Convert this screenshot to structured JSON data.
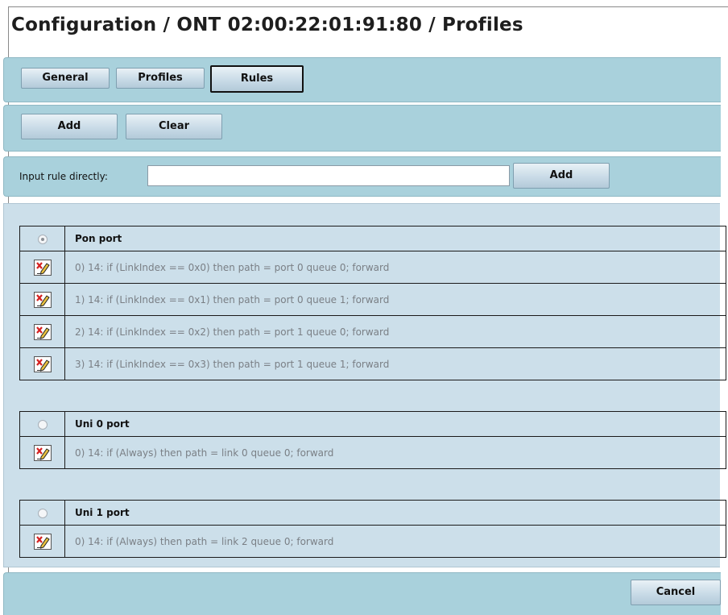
{
  "header": {
    "title": "Configuration / ONT 02:00:22:01:91:80 / Profiles"
  },
  "tabs": [
    {
      "label": "General",
      "active": false
    },
    {
      "label": "Profiles",
      "active": false
    },
    {
      "label": "Rules",
      "active": true
    }
  ],
  "toolbar": {
    "add_label": "Add",
    "clear_label": "Clear"
  },
  "direct_input": {
    "label": "Input rule directly:",
    "value": "",
    "placeholder": "",
    "add_label": "Add"
  },
  "ports": [
    {
      "name": "Pon port",
      "selected": true,
      "rules": [
        "0) 14: if (LinkIndex == 0x0) then path = port 0 queue 0; forward",
        "1) 14: if (LinkIndex == 0x1) then path = port 0 queue 1; forward",
        "2) 14: if (LinkIndex == 0x2) then path = port 1 queue 0; forward",
        "3) 14: if (LinkIndex == 0x3) then path = port 1 queue 1; forward"
      ]
    },
    {
      "name": "Uni 0 port",
      "selected": false,
      "rules": [
        "0) 14: if (Always) then path = link 0 queue 0; forward"
      ]
    },
    {
      "name": "Uni 1 port",
      "selected": false,
      "rules": [
        "0) 14: if (Always) then path = link 2 queue 0; forward"
      ]
    }
  ],
  "footer": {
    "cancel_label": "Cancel"
  },
  "icons": {
    "radio": "radio-icon",
    "edit": "edit-rule-icon"
  },
  "colors": {
    "band": "#a9d1dc",
    "panel": "#ccdfea",
    "button": "#c9dbe7"
  }
}
